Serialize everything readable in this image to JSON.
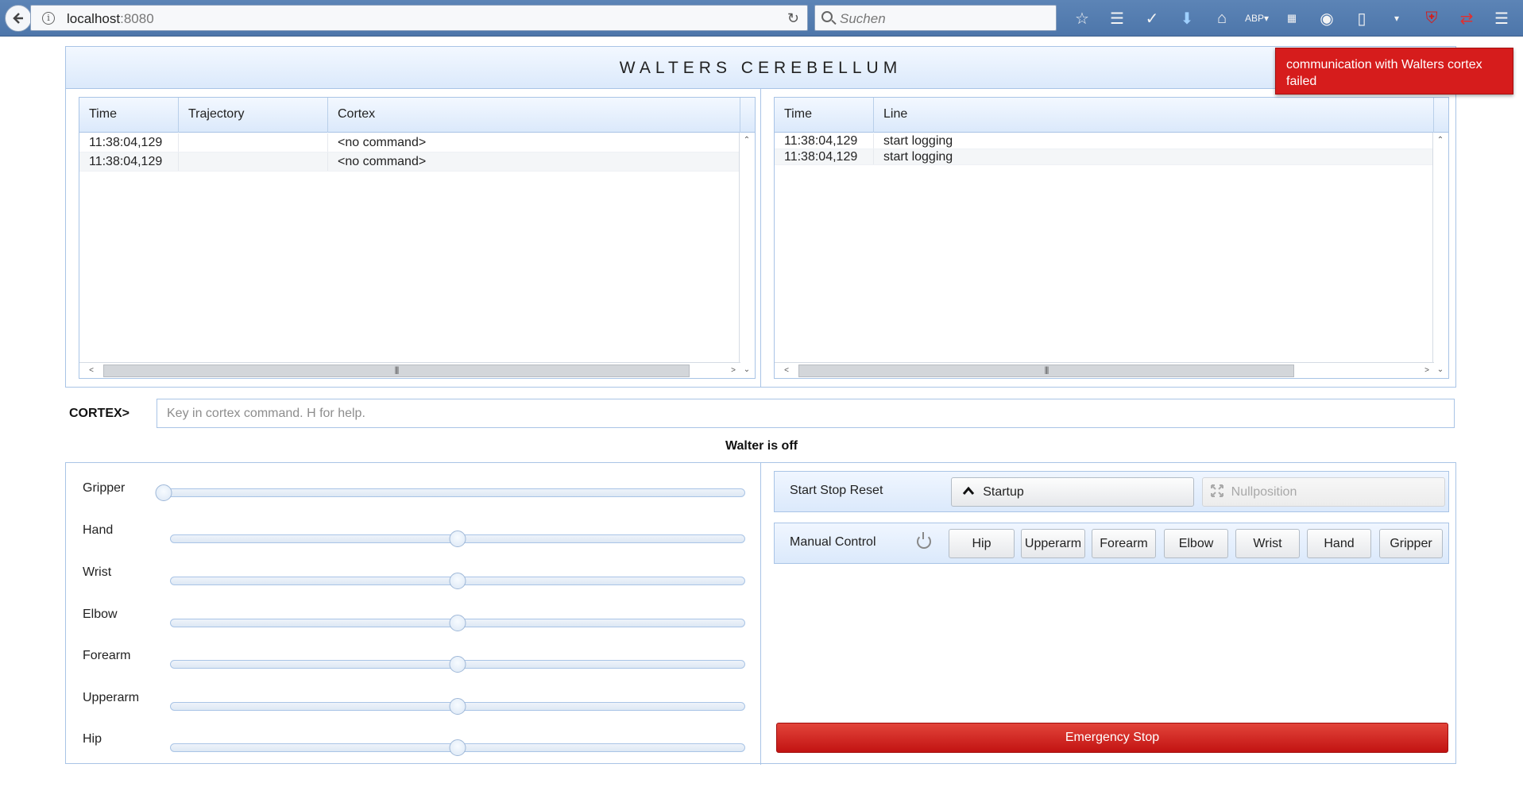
{
  "browser": {
    "url_host": "localhost",
    "url_port": ":8080",
    "search_placeholder": "Suchen",
    "toolbar_icons": [
      "star-icon",
      "reading-list-icon",
      "pocket-icon",
      "download-icon",
      "home-icon",
      "adblock-icon",
      "dropdown-icon",
      "extension-icon",
      "extension-icon",
      "extension-icon",
      "dropdown-icon",
      "ublock-icon",
      "sync-icon",
      "menu-icon"
    ]
  },
  "app": {
    "title": "WALTERS CEREBELLUM"
  },
  "notification": {
    "text": "communication with Walters cortex failed",
    "color": "#d61c1c"
  },
  "command_log": {
    "columns": [
      "Time",
      "Trajectory",
      "Cortex"
    ],
    "rows": [
      {
        "time": "11:38:04,129",
        "trajectory": "",
        "cortex": "<no command>"
      },
      {
        "time": "11:38:04,129",
        "trajectory": "",
        "cortex": "<no command>"
      }
    ]
  },
  "line_log": {
    "columns": [
      "Time",
      "Line"
    ],
    "rows": [
      {
        "time": "11:38:04,129",
        "line": "start logging"
      },
      {
        "time": "11:38:04,129",
        "line": "start logging"
      }
    ]
  },
  "cortex": {
    "label": "CORTEX>",
    "placeholder": "Key in cortex command. H for help."
  },
  "status": "Walter is off",
  "sliders": [
    {
      "label": "Gripper",
      "value": 0
    },
    {
      "label": "Hand",
      "value": 0.5
    },
    {
      "label": "Wrist",
      "value": 0.5
    },
    {
      "label": "Elbow",
      "value": 0.5
    },
    {
      "label": "Forearm",
      "value": 0.5
    },
    {
      "label": "Upperarm",
      "value": 0.5
    },
    {
      "label": "Hip",
      "value": 0.5
    }
  ],
  "start_stop": {
    "label": "Start Stop Reset",
    "startup_label": "Startup",
    "nullposition_label": "Nullposition"
  },
  "manual_control": {
    "label": "Manual Control",
    "buttons": [
      "Hip",
      "Upperarm",
      "Forearm",
      "Elbow",
      "Wrist",
      "Hand",
      "Gripper"
    ]
  },
  "emergency_stop": "Emergency Stop"
}
